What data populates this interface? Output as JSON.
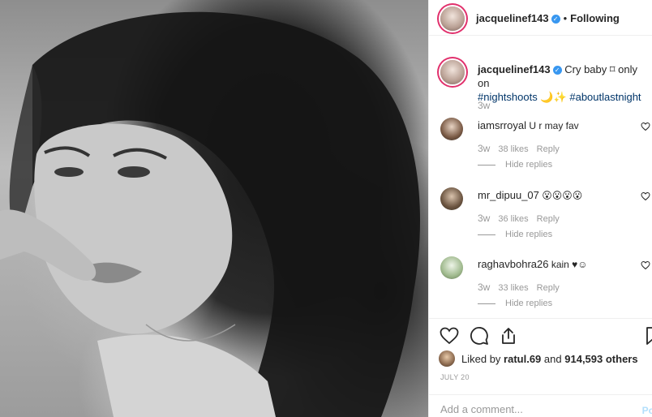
{
  "post": {
    "author": "jacquelinef143",
    "following_label": "Following",
    "separator": "•",
    "caption": {
      "text": "Cry baby ⌑ only on",
      "hashtag1": "#nightshoots",
      "emojis": "🌙✨",
      "hashtag2": "#aboutlastnight"
    },
    "caption_time": "3w"
  },
  "comments": [
    {
      "user": "iamsrroyal",
      "text": "U r may fav",
      "time": "3w",
      "likes": "38 likes",
      "reply": "Reply",
      "hide": "Hide replies"
    },
    {
      "user": "mr_dipuu_07",
      "text": "😮😮😮😮",
      "time": "3w",
      "likes": "36 likes",
      "reply": "Reply",
      "hide": "Hide replies"
    },
    {
      "user": "raghavbohra26",
      "text": "kain ♥☺",
      "time": "3w",
      "likes": "33 likes",
      "reply": "Reply",
      "hide": "Hide replies"
    }
  ],
  "likes": {
    "prefix": "Liked by",
    "user": "ratul.69",
    "middle": "and",
    "count": "914,593 others"
  },
  "date": "JULY 20",
  "add_comment": {
    "placeholder": "Add a comment...",
    "post_label": "Po"
  },
  "icons": [
    "heart-icon",
    "comment-icon",
    "share-icon",
    "bookmark-icon",
    "verified-icon"
  ],
  "colors": {
    "hashtag": "#003569",
    "verified": "#3897f0",
    "muted": "#999999",
    "post_button": "#b2dffc"
  }
}
